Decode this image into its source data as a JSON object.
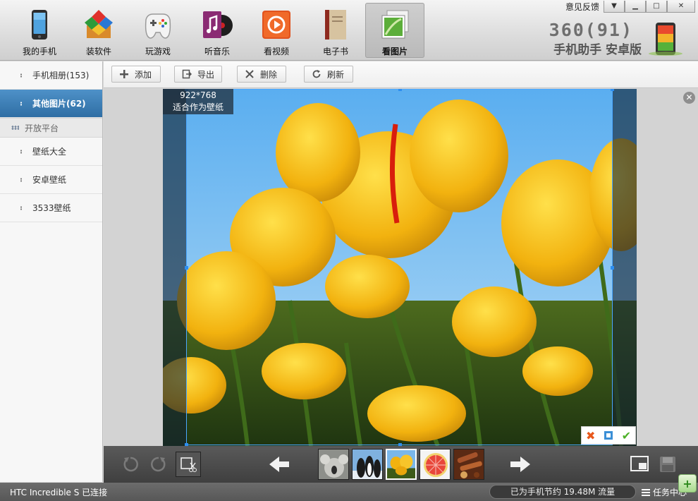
{
  "window": {
    "feedback": "意见反馈",
    "brand_number": "360(91)",
    "brand_subtitle": "手机助手 安卓版"
  },
  "nav": [
    {
      "label": "我的手机",
      "icon": "phone-icon"
    },
    {
      "label": "装软件",
      "icon": "software-box-icon"
    },
    {
      "label": "玩游戏",
      "icon": "gamepad-icon"
    },
    {
      "label": "听音乐",
      "icon": "music-icon"
    },
    {
      "label": "看视频",
      "icon": "video-play-icon"
    },
    {
      "label": "电子书",
      "icon": "ebook-icon"
    },
    {
      "label": "看图片",
      "icon": "picture-icon",
      "active": true
    }
  ],
  "sidebar": {
    "items_top": [
      {
        "label": "手机相册(153)"
      },
      {
        "label": "其他图片(62)",
        "active": true
      }
    ],
    "section": "开放平台",
    "items_platform": [
      {
        "label": "壁纸大全"
      },
      {
        "label": "安卓壁纸"
      },
      {
        "label": "3533壁纸"
      }
    ]
  },
  "toolbar": {
    "add": "添加",
    "export": "导出",
    "delete": "删除",
    "refresh": "刷新"
  },
  "viewer": {
    "resolution": "922*768",
    "hint": "适合作为壁纸"
  },
  "thumbnails": [
    "koala",
    "penguins",
    "tulips",
    "grapefruit",
    "spices"
  ],
  "status": {
    "device": "HTC Incredible S 已连接",
    "traffic": "已为手机节约 19.48M 流量",
    "task_center": "任务中心"
  },
  "colors": {
    "accent": "#2f6ea4",
    "crop_border": "#4aa7ff"
  }
}
